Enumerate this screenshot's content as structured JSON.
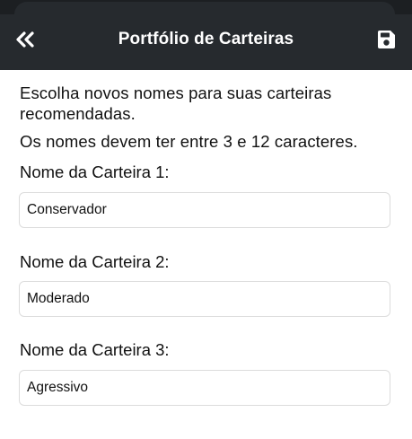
{
  "header": {
    "title": "Portfólio de Carteiras",
    "back_icon": "double-chevron-left-icon",
    "save_icon": "floppy-disk-icon",
    "background": "#262a2e"
  },
  "intro": {
    "text": "Escolha novos nomes para suas carteiras recomendadas.",
    "rule": "Os nomes devem ter entre 3 e 12 caracteres."
  },
  "fields": [
    {
      "label": "Nome da Carteira 1:",
      "value": "Conservador"
    },
    {
      "label": "Nome da Carteira 2:",
      "value": "Moderado"
    },
    {
      "label": "Nome da Carteira 3:",
      "value": "Agressivo"
    }
  ]
}
